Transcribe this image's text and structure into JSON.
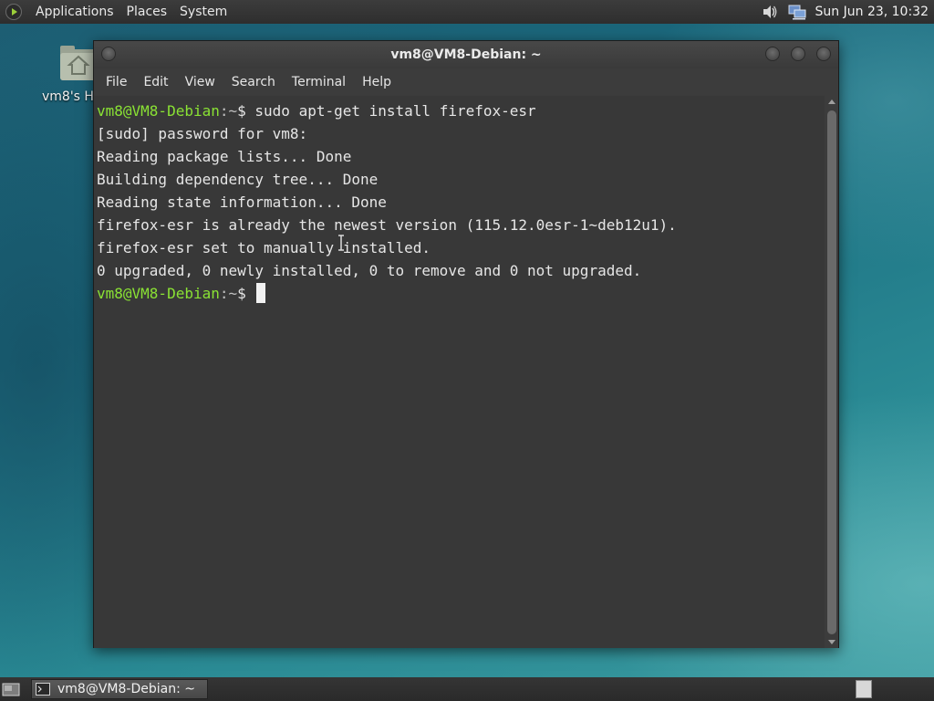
{
  "top_panel": {
    "menus": [
      "Applications",
      "Places",
      "System"
    ],
    "clock": "Sun Jun 23, 10:32",
    "icons": [
      "main-menu-foot-icon",
      "volume-icon",
      "network-icon"
    ]
  },
  "desktop": {
    "home_icon_label": "vm8's H"
  },
  "window": {
    "title": "vm8@VM8-Debian: ~",
    "menus": [
      "File",
      "Edit",
      "View",
      "Search",
      "Terminal",
      "Help"
    ],
    "terminal": {
      "prompt_user": "vm8@VM8-Debian",
      "prompt_path": ":~",
      "prompt_symbol": "$",
      "command": " sudo apt-get install firefox-esr",
      "output": [
        "[sudo] password for vm8:",
        "Reading package lists... Done",
        "Building dependency tree... Done",
        "Reading state information... Done",
        "firefox-esr is already the newest version (115.12.0esr-1~deb12u1).",
        "firefox-esr set to manually installed.",
        "0 upgraded, 0 newly installed, 0 to remove and 0 not upgraded."
      ]
    }
  },
  "bottom_panel": {
    "task_label": "vm8@VM8-Debian: ~"
  },
  "colors": {
    "prompt_green": "#8ae234",
    "terminal_bg": "#383838"
  }
}
